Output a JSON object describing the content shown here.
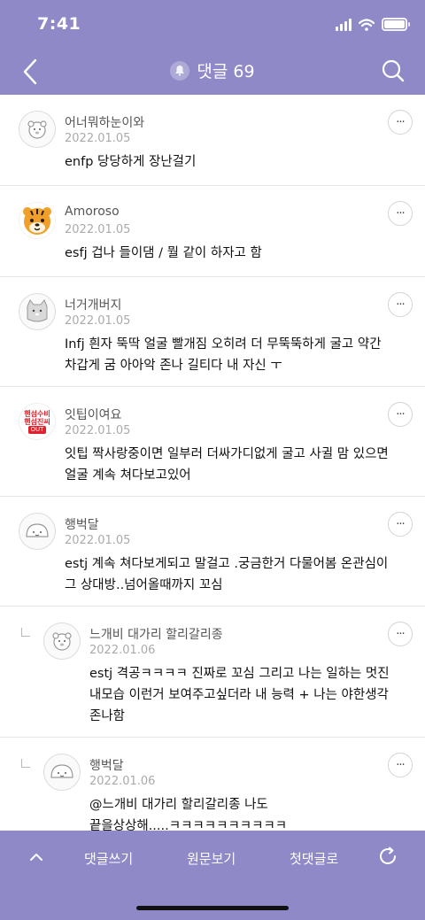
{
  "status_bar": {
    "time": "7:41"
  },
  "header": {
    "title": "댓글 69"
  },
  "comments": [
    {
      "nickname": "어너뭐하눈이와",
      "date": "2022.01.05",
      "lines": [
        "enfp 당당하게 장난걸기"
      ]
    },
    {
      "nickname": "Amoroso",
      "date": "2022.01.05",
      "lines": [
        "esfj 겁나 들이댐 / 뭘 같이 하자고 함"
      ]
    },
    {
      "nickname": "너거개버지",
      "date": "2022.01.05",
      "lines": [
        "Infj 흰자 뚝딱 얼굴 빨개짐 오히려 더 무뚝뚝하게 굴고 약간",
        "차갑게 굼 아아악 존나 길티다 내 자신 ㅜ"
      ]
    },
    {
      "nickname": "잇팁이여요",
      "date": "2022.01.05",
      "lines": [
        "잇팁 짝사랑중이면 일부러 더싸가디없게 굴고 사귈 맘 있으면",
        "얼굴 계속 쳐다보고있어"
      ]
    },
    {
      "nickname": "행벅달",
      "date": "2022.01.05",
      "lines": [
        "estj 계속 쳐다보게되고 말걸고 .궁금한거 다물어봄 온관심이",
        "그 상대방..넘어올때까지 꼬심"
      ]
    },
    {
      "nickname": "느개비 대가리 할리갈리종",
      "date": "2022.01.06",
      "lines": [
        "estj 격공ㅋㅋㅋㅋ 진짜로 꼬심 그리고 나는 일하는 멋진",
        "내모습 이런거 보여주고싶더라 내 능력 + 나는 야한생각",
        "존나함"
      ]
    },
    {
      "nickname": "행벅달",
      "date": "2022.01.06",
      "lines": [
        "@느개비 대가리 할리갈리종  나도",
        "끝을상상해.....ㅋㅋㅋㅋㅋㅋㅋㅋㅋㅋ"
      ]
    }
  ],
  "avatar_badge": {
    "line1": "핸섬수비",
    "line2": "핸섬진씨",
    "line3": "OUT"
  },
  "more_icon_text": "···",
  "bottom_bar": {
    "write": "댓글쓰기",
    "original": "원문보기",
    "first": "첫댓글로"
  },
  "colors": {
    "bar": "#8f89c8",
    "divider": "#e6e6e6",
    "tiger": "#f0a02a"
  }
}
